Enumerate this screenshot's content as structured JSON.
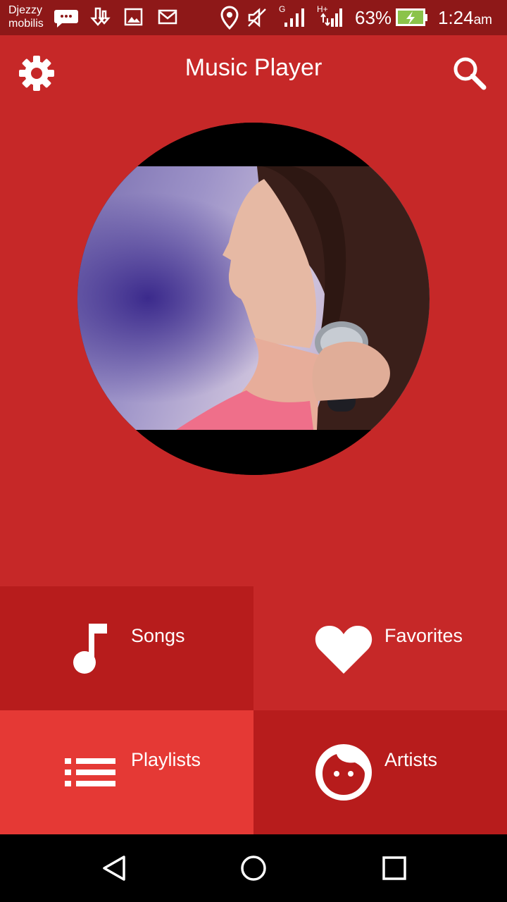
{
  "status_bar": {
    "carrier_line1": "Djezzy",
    "carrier_line2": "mobilis",
    "network_labels": [
      "G",
      "H+"
    ],
    "battery_percent": "63%",
    "time": "1:24",
    "time_suffix": "am",
    "icons": [
      "chat-icon",
      "download-icon",
      "image-icon",
      "mail-icon",
      "location-icon",
      "mute-icon",
      "signal-icon",
      "signal-icon",
      "battery-charging-icon"
    ]
  },
  "app_bar": {
    "title": "Music Player",
    "left_icon": "gear-icon",
    "right_icon": "search-icon"
  },
  "album_art": {
    "description_icon": "album-art-image"
  },
  "menu": {
    "songs": {
      "label": "Songs",
      "icon": "music-note-icon"
    },
    "favorites": {
      "label": "Favorites",
      "icon": "heart-icon"
    },
    "playlists": {
      "label": "Playlists",
      "icon": "list-icon"
    },
    "artists": {
      "label": "Artists",
      "icon": "artist-face-icon"
    }
  },
  "colors": {
    "primary": "#c62828",
    "primary_dark": "#b71c1c",
    "accent_light": "#e53935",
    "status_bar": "#8e1818"
  },
  "nav_bar": {
    "icons": [
      "back-icon",
      "home-icon",
      "recents-icon"
    ]
  }
}
